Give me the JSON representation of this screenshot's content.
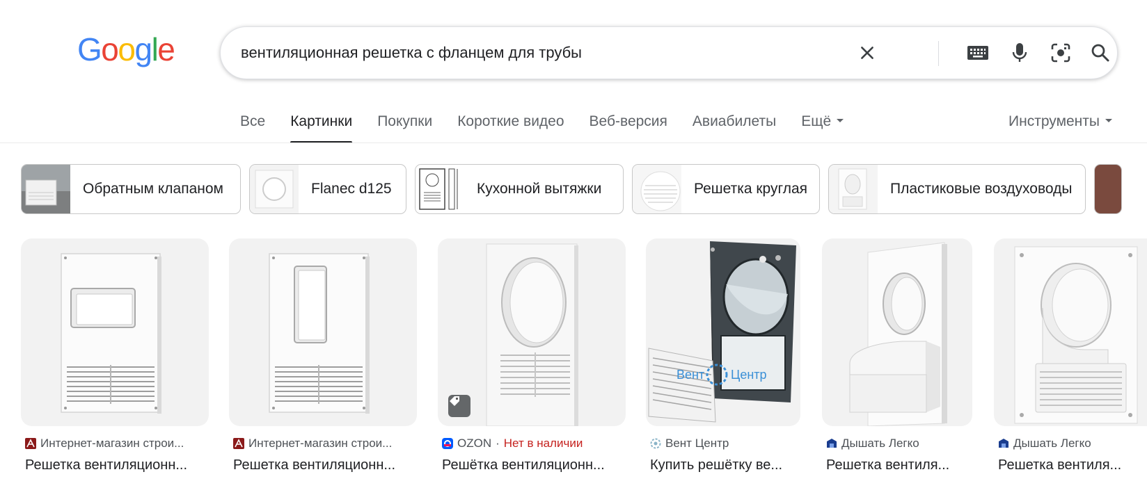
{
  "logo": {
    "letters": [
      "G",
      "o",
      "o",
      "g",
      "l",
      "e"
    ],
    "colors": [
      "#4285f4",
      "#ea4335",
      "#fbbc05",
      "#4285f4",
      "#34a853",
      "#ea4335"
    ]
  },
  "search": {
    "query": "вентиляционная решетка с фланцем для трубы"
  },
  "icons": {
    "clear": "close-icon",
    "keyboard": "keyboard-icon",
    "voice": "microphone-icon",
    "lens": "lens-icon",
    "search": "search-icon"
  },
  "tabs": [
    {
      "label": "Все",
      "active": false
    },
    {
      "label": "Картинки",
      "active": true
    },
    {
      "label": "Покупки",
      "active": false
    },
    {
      "label": "Короткие видео",
      "active": false
    },
    {
      "label": "Веб-версия",
      "active": false
    },
    {
      "label": "Авиабилеты",
      "active": false
    },
    {
      "label": "Ещё",
      "active": false
    }
  ],
  "tools_label": "Инструменты",
  "chips": [
    {
      "label": "Обратным клапаном"
    },
    {
      "label": "Flanec d125"
    },
    {
      "label": "Кухонной вытяжки"
    },
    {
      "label": "Решетка круглая"
    },
    {
      "label": "Пластиковые воздуховоды"
    }
  ],
  "results": [
    {
      "source": "Интернет-магазин строи...",
      "title": "Решетка вентиляционн...",
      "favicon_color": "#8b1a1a"
    },
    {
      "source": "Интернет-магазин строи...",
      "title": "Решетка вентиляционн...",
      "favicon_color": "#8b1a1a"
    },
    {
      "source": "OZON",
      "stock": "Нет в наличии",
      "title": "Решётка вентиляционн...",
      "favicon_color": "#005bff"
    },
    {
      "source": "Вент Центр",
      "title": "Купить решётку ве...",
      "favicon_color": "#8ab4c8"
    },
    {
      "source": "Дышать Легко",
      "title": "Решетка вентиля...",
      "favicon_color": "#1a3d8f"
    },
    {
      "source": "Дышать Легко",
      "title": "Решетка вентиля...",
      "favicon_color": "#1a3d8f"
    }
  ],
  "colors": {
    "active_tab_underline": "#202124",
    "out_of_stock": "#c5221f",
    "watermark": "#3a8fd6"
  },
  "watermark": {
    "left": "Вент",
    "right": "Центр"
  }
}
